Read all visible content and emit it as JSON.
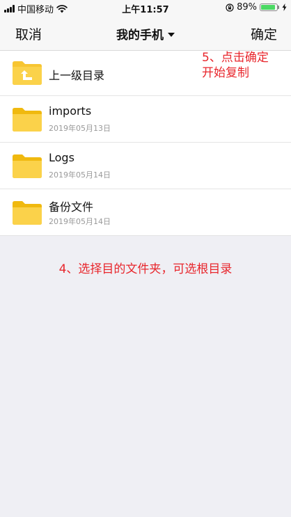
{
  "status_bar": {
    "carrier": "中国移动",
    "time": "上午11:57",
    "battery_percent": "89%",
    "battery_level": 0.89,
    "signal_icon": "signal-icon",
    "wifi_icon": "wifi-icon",
    "lock_icon": "orientation-lock-icon",
    "charging_icon": "charging-icon"
  },
  "nav": {
    "cancel_label": "取消",
    "title": "我的手机",
    "confirm_label": "确定"
  },
  "list": {
    "up_label": "上一级目录",
    "items": [
      {
        "name": "imports",
        "date": "2019年05月13日"
      },
      {
        "name": "Logs",
        "date": "2019年05月14日"
      },
      {
        "name": "备份文件",
        "date": "2019年05月14日"
      }
    ]
  },
  "annotations": {
    "step5_line1": "5、点击确定",
    "step5_line2": "开始复制",
    "step4": "4、选择目的文件夹，可选根目录"
  },
  "colors": {
    "annotation": "#e8262c",
    "folder": "#f7c531",
    "battery": "#4cd964"
  }
}
